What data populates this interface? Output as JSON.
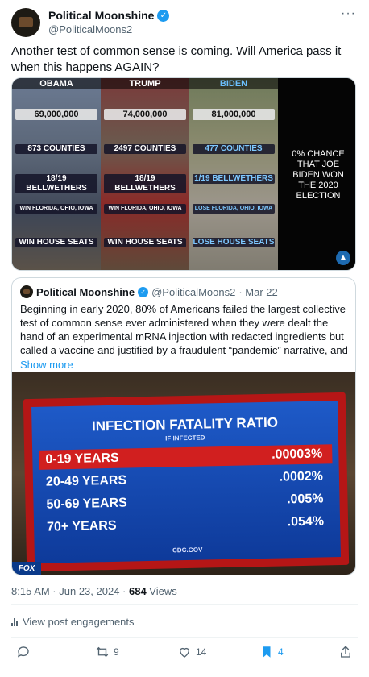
{
  "tweet": {
    "author_name": "Political Moonshine",
    "handle": "@PoliticalMoons2",
    "text": "Another test of common sense is coming. Will America pass it when this happens AGAIN?",
    "timestamp": "8:15 AM · Jun 23, 2024 · ",
    "views_count": "684",
    "views_label": " Views",
    "engagements_label": "View post engagements"
  },
  "media": {
    "columns": [
      {
        "header": "OBAMA",
        "votes": "69,000,000",
        "counties": "873 COUNTIES",
        "bellwethers": "18/19 BELLWETHERS",
        "states": "WIN FLORIDA, OHIO, IOWA",
        "house": "WIN HOUSE SEATS"
      },
      {
        "header": "TRUMP",
        "votes": "74,000,000",
        "counties": "2497 COUNTIES",
        "bellwethers": "18/19 BELLWETHERS",
        "states": "WIN FLORIDA, OHIO, IOWA",
        "house": "WIN HOUSE SEATS"
      },
      {
        "header": "BIDEN",
        "votes": "81,000,000",
        "counties": "477 COUNTIES",
        "bellwethers": "1/19 BELLWETHERS",
        "states": "LOSE FLORIDA, OHIO, IOWA",
        "house": "LOSE HOUSE SEATS"
      }
    ],
    "side_text": "0% CHANCE THAT JOE BIDEN WON THE 2020 ELECTION"
  },
  "quote": {
    "author_name": "Political Moonshine",
    "handle": "@PoliticalMoons2",
    "date": "· Mar 22",
    "text": "Beginning in early 2020, 80% of Americans failed the largest collective test of common sense ever administered when they were dealt the hand of an experimental mRNA injection with redacted ingredients but called a vaccine and justified by a fraudulent “pandemic” narrative, and",
    "show_more": "Show more",
    "image": {
      "title": "INFECTION FATALITY RATIO",
      "subtitle": "IF INFECTED",
      "rows": [
        {
          "label": "0-19 YEARS",
          "value": ".00003%"
        },
        {
          "label": "20-49 YEARS",
          "value": ".0002%"
        },
        {
          "label": "50-69 YEARS",
          "value": ".005%"
        },
        {
          "label": "70+ YEARS",
          "value": ".054%"
        }
      ],
      "source": "CDC.GOV",
      "network": "FOX"
    }
  },
  "actions": {
    "reply_count": "",
    "retweet_count": "9",
    "like_count": "14",
    "bookmark_count": "4"
  },
  "colors": {
    "accent": "#1d9bf0",
    "text_secondary": "#536471",
    "tv_frame": "#b51616",
    "tv_screen": "#1e5ac8",
    "highlight_row": "#d11f1f"
  }
}
